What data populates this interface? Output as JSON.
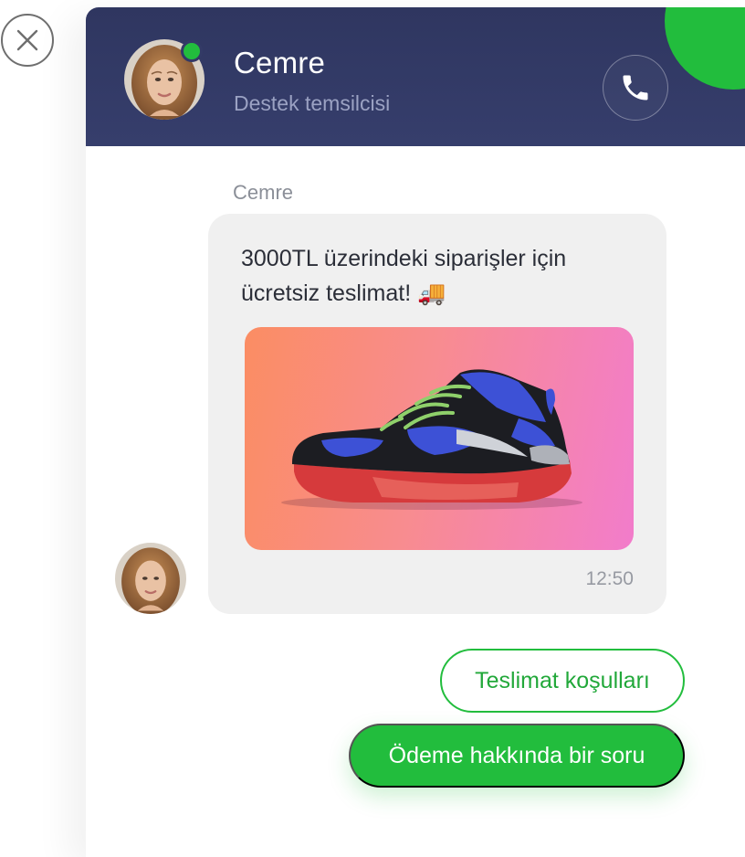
{
  "header": {
    "agent_name": "Cemre",
    "agent_role": "Destek temsilcisi",
    "status": "online"
  },
  "message": {
    "sender": "Cemre",
    "text": "3000TL üzerindeki siparişler için ücretsiz teslimat! 🚚",
    "image": "sneaker-product",
    "time": "12:50"
  },
  "quick_replies": [
    {
      "label": "Teslimat koşulları",
      "style": "outline"
    },
    {
      "label": "Ödeme hakkında bir soru",
      "style": "filled"
    }
  ],
  "icons": {
    "close": "close-icon",
    "call": "phone-icon"
  },
  "colors": {
    "brand_green": "#22bd3d",
    "header_navy": "#333a66",
    "bubble_bg": "#f0f0f0"
  }
}
